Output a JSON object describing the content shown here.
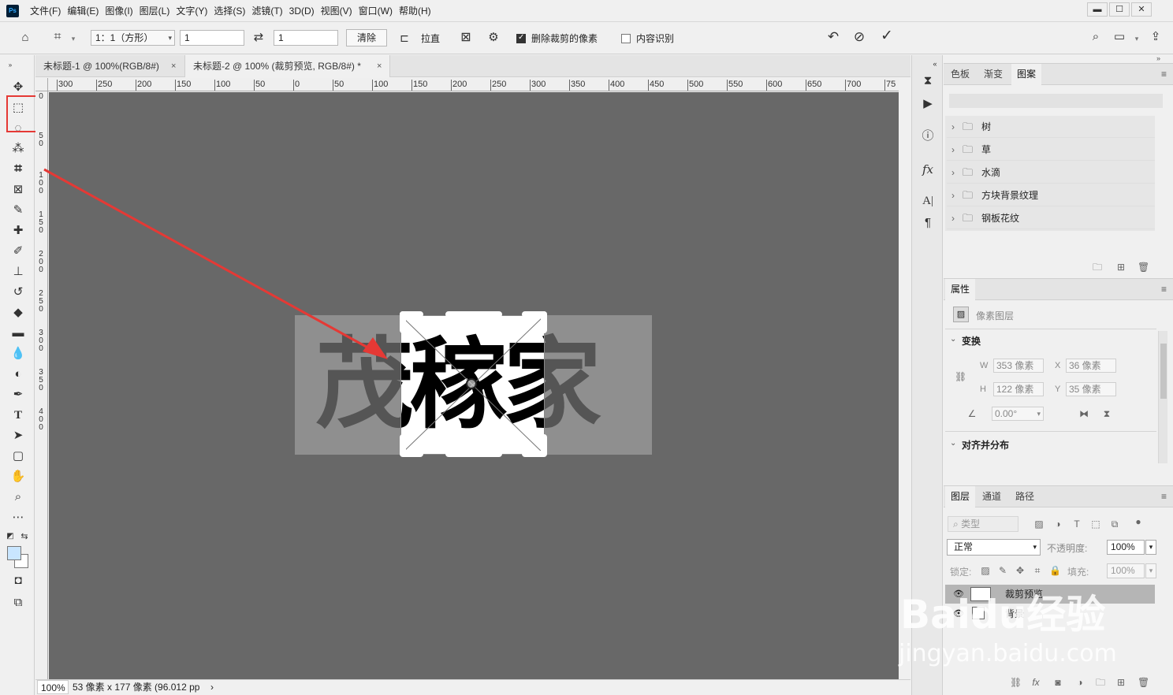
{
  "menubar": {
    "logo": "Ps",
    "items": [
      "文件(F)",
      "编辑(E)",
      "图像(I)",
      "图层(L)",
      "文字(Y)",
      "选择(S)",
      "滤镜(T)",
      "3D(D)",
      "视图(V)",
      "窗口(W)",
      "帮助(H)"
    ],
    "window_controls": {
      "minimize": "▬",
      "maximize": "☐",
      "close": "✕"
    }
  },
  "options": {
    "ratio_select": "1：1（方形）",
    "width_value": "1",
    "swap_icon": "⇄",
    "height_value": "1",
    "clear_label": "清除",
    "straighten_label": "拉直",
    "delete_cropped_label": "删除裁剪的像素",
    "delete_cropped_checked": true,
    "content_aware_label": "内容识别",
    "content_aware_checked": false
  },
  "tabs": [
    {
      "label": "未标题-1 @ 100%(RGB/8#)",
      "close": "×",
      "active": false
    },
    {
      "label": "未标题-2 @ 100% (裁剪预览, RGB/8#) *",
      "close": "×",
      "active": true
    }
  ],
  "ruler": {
    "top_labels": [
      "300",
      "250",
      "200",
      "150",
      "100",
      "50",
      "0",
      "50",
      "100",
      "150",
      "200",
      "250",
      "300",
      "350",
      "400",
      "450",
      "500",
      "550",
      "600",
      "650",
      "700",
      "75"
    ],
    "left_labels": [
      "0",
      "50",
      "100",
      "150",
      "200",
      "250",
      "300",
      "350",
      "400"
    ]
  },
  "canvas": {
    "text": "茂稼家",
    "crop_text": "茂稼"
  },
  "status": {
    "zoom": "100%",
    "info": "53 像素 x 177 像素 (96.012 pp",
    "arrow": "›"
  },
  "patterns_panel": {
    "tabs": [
      "色板",
      "渐变",
      "图案"
    ],
    "active_tab": "图案",
    "folders": [
      "树",
      "草",
      "水滴",
      "方块背景纹理",
      "钢板花纹"
    ]
  },
  "properties_panel": {
    "tab": "属性",
    "layer_type": "像素图层",
    "transform_header": "变换",
    "w_label": "W",
    "w_value": "353 像素",
    "x_label": "X",
    "x_value": "36 像素",
    "h_label": "H",
    "h_value": "122 像素",
    "y_label": "Y",
    "y_value": "35 像素",
    "angle_value": "0.00°",
    "align_header": "对齐并分布"
  },
  "layers_panel": {
    "tabs": [
      "图层",
      "通道",
      "路径"
    ],
    "active_tab": "图层",
    "filter_placeholder": "类型",
    "blend_mode": "正常",
    "opacity_label": "不透明度:",
    "opacity_value": "100%",
    "lock_label": "锁定:",
    "fill_label": "填充:",
    "fill_value": "100%",
    "layers": [
      {
        "name": "裁剪预览",
        "selected": true
      },
      {
        "name": "背景",
        "selected": false
      }
    ]
  },
  "watermark": {
    "brand": "Baidu经验",
    "url": "jingyan.baidu.com"
  },
  "colors": {
    "accent_red": "#e53935",
    "canvas_bg": "#686868",
    "foreground_swatch": "#c9e6ff"
  }
}
